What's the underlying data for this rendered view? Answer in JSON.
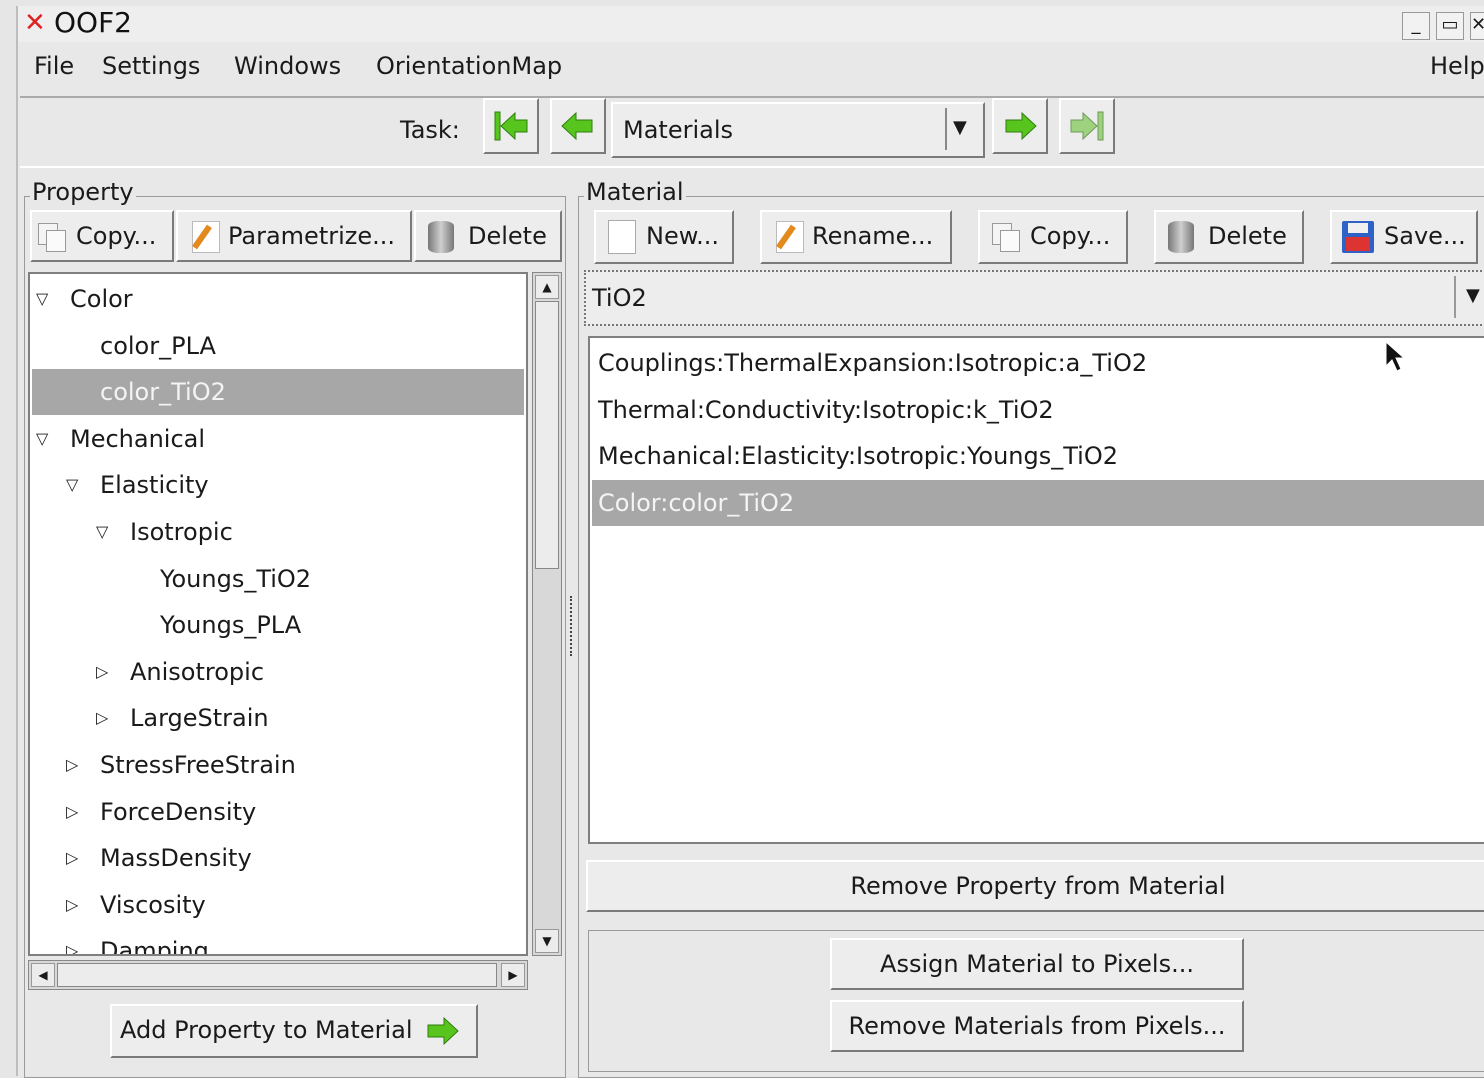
{
  "window": {
    "title": "OOF2",
    "close_glyph": "✕",
    "wm_minimize": "_",
    "wm_restore": "▭"
  },
  "menubar": {
    "items": [
      "File",
      "Settings",
      "Windows",
      "OrientationMap"
    ],
    "help": "Help"
  },
  "toolbar": {
    "task_label": "Task:",
    "task_value": "Materials",
    "first_icon": "first-arrow-icon",
    "prev_icon": "prev-arrow-icon",
    "next_icon": "next-arrow-icon",
    "last_icon": "last-arrow-icon",
    "arrow_color": "#58c51f"
  },
  "property_panel": {
    "label": "Property",
    "buttons": {
      "copy": "Copy...",
      "parametrize": "Parametrize...",
      "delete": "Delete"
    },
    "tree": [
      {
        "label": "Color",
        "expander": "▽",
        "level": 0
      },
      {
        "label": "color_PLA",
        "expander": "",
        "level": 1
      },
      {
        "label": "color_TiO2",
        "expander": "",
        "level": 1,
        "selected": true
      },
      {
        "label": "Mechanical",
        "expander": "▽",
        "level": 0
      },
      {
        "label": "Elasticity",
        "expander": "▽",
        "level": 1
      },
      {
        "label": "Isotropic",
        "expander": "▽",
        "level": 2
      },
      {
        "label": "Youngs_TiO2",
        "expander": "",
        "level": 3
      },
      {
        "label": "Youngs_PLA",
        "expander": "",
        "level": 3
      },
      {
        "label": "Anisotropic",
        "expander": "▷",
        "level": 2
      },
      {
        "label": "LargeStrain",
        "expander": "▷",
        "level": 2
      },
      {
        "label": "StressFreeStrain",
        "expander": "▷",
        "level": 1
      },
      {
        "label": "ForceDensity",
        "expander": "▷",
        "level": 1
      },
      {
        "label": "MassDensity",
        "expander": "▷",
        "level": 1
      },
      {
        "label": "Viscosity",
        "expander": "▷",
        "level": 1
      },
      {
        "label": "Damping",
        "expander": "▷",
        "level": 1
      }
    ],
    "add_button": "Add Property to Material"
  },
  "material_panel": {
    "label": "Material",
    "buttons": {
      "new": "New...",
      "rename": "Rename...",
      "copy": "Copy...",
      "delete": "Delete",
      "save": "Save..."
    },
    "selected_material": "TiO2",
    "properties": [
      {
        "label": "Couplings:ThermalExpansion:Isotropic:a_TiO2"
      },
      {
        "label": "Thermal:Conductivity:Isotropic:k_TiO2"
      },
      {
        "label": "Mechanical:Elasticity:Isotropic:Youngs_TiO2"
      },
      {
        "label": "Color:color_TiO2",
        "selected": true
      }
    ],
    "remove_property_button": "Remove Property from Material",
    "assign_button": "Assign Material to Pixels...",
    "remove_materials_button": "Remove Materials from Pixels..."
  }
}
